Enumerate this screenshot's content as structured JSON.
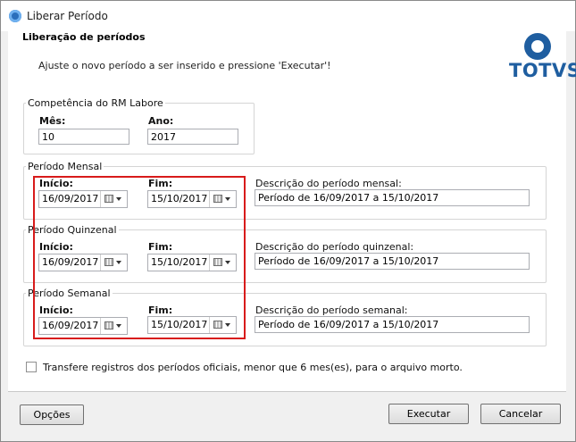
{
  "window": {
    "title": "Liberar Período"
  },
  "header": {
    "title": "Liberação de períodos",
    "subtitle": "Ajuste o novo período a ser inserido e pressione 'Executar'!",
    "logo_text": "TOTVS"
  },
  "competencia": {
    "legend": "Competência do RM Labore",
    "mes_label": "Mês:",
    "mes_value": "10",
    "ano_label": "Ano:",
    "ano_value": "2017"
  },
  "mensal": {
    "legend": "Período Mensal",
    "inicio_label": "Início:",
    "inicio_value": "16/09/2017",
    "fim_label": "Fim:",
    "fim_value": "15/10/2017",
    "descricao_label": "Descrição do período mensal:",
    "descricao_value": "Período de 16/09/2017 a 15/10/2017"
  },
  "quinzenal": {
    "legend": "Período Quinzenal",
    "inicio_label": "Início:",
    "inicio_value": "16/09/2017",
    "fim_label": "Fim:",
    "fim_value": "15/10/2017",
    "descricao_label": "Descrição do período quinzenal:",
    "descricao_value": "Período de 16/09/2017 a 15/10/2017"
  },
  "semanal": {
    "legend": "Período Semanal",
    "inicio_label": "Início:",
    "inicio_value": "16/09/2017",
    "fim_label": "Fim:",
    "fim_value": "15/10/2017",
    "descricao_label": "Descrição do período semanal:",
    "descricao_value": "Período de 16/09/2017 a 15/10/2017"
  },
  "arquivo_morto": {
    "label": "Transfere registros dos períodos oficiais, menor que 6 mes(es), para o arquivo morto.",
    "checked": false
  },
  "buttons": {
    "opcoes": "Opções",
    "executar": "Executar",
    "cancelar": "Cancelar"
  },
  "colors": {
    "brand": "#1f5ea0",
    "highlight": "#d81b1b"
  },
  "icons": {
    "app": "totvs-logo-icon",
    "calendar": "calendar-icon",
    "dropdown": "chevron-down-icon"
  }
}
